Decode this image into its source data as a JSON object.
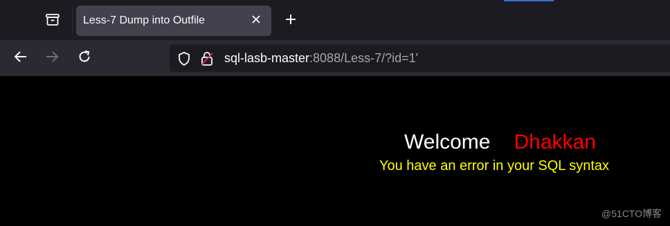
{
  "browser": {
    "tab": {
      "title": "Less-7 Dump into Outfile"
    },
    "address": {
      "host": "sql-lasb-master",
      "rest": ":8088/Less-7/?id=1'"
    },
    "icons": {
      "tabs_list": "tabs-list-icon",
      "tab_close": "close-icon",
      "new_tab": "plus-icon",
      "back": "back-arrow-icon",
      "forward": "forward-arrow-icon",
      "reload": "reload-icon",
      "tracking_protection": "shield-icon",
      "insecure": "insecure-lock-icon"
    },
    "colors": {
      "tabbar": "#1c1b22",
      "active_tab": "#42414d",
      "navbar": "#2b2a33",
      "urlbar": "#1c1b22"
    }
  },
  "page": {
    "welcome": "Welcome",
    "name": "Dhakkan",
    "error": "You have an error in your SQL syntax",
    "watermark": "@51CTO博客",
    "colors": {
      "background": "#000000",
      "welcome": "#ffffff",
      "name": "#ff0000",
      "error": "#ffff00"
    }
  }
}
